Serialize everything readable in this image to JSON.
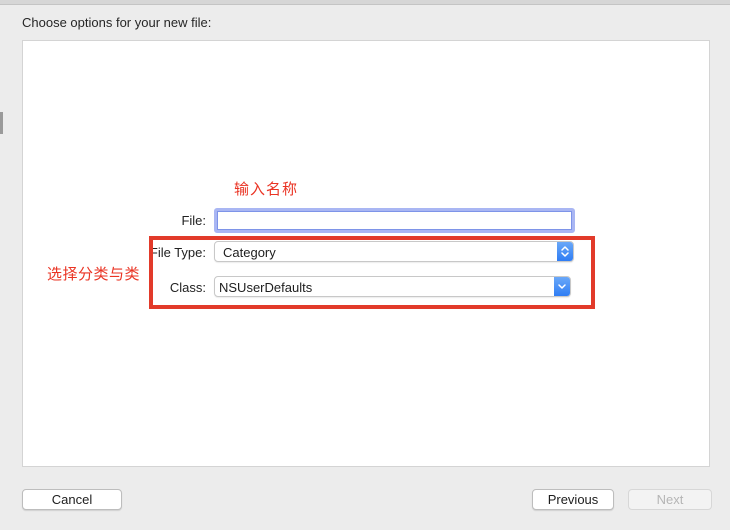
{
  "dialog": {
    "title": "Choose options for your new file:"
  },
  "annotations": {
    "name_hint": "输入名称",
    "choose_hint": "选择分类与类",
    "highlight_color": "#e23a2a"
  },
  "form": {
    "file_label": "File:",
    "file_value": "",
    "file_type_label": "File Type:",
    "file_type_value": "Category",
    "class_label": "Class:",
    "class_value": "NSUserDefaults"
  },
  "buttons": {
    "cancel": "Cancel",
    "previous": "Previous",
    "next": "Next"
  },
  "icons": {
    "popup_type_indicator": "up-down-chevron-icon",
    "popup_class_indicator": "chevron-down-icon"
  }
}
